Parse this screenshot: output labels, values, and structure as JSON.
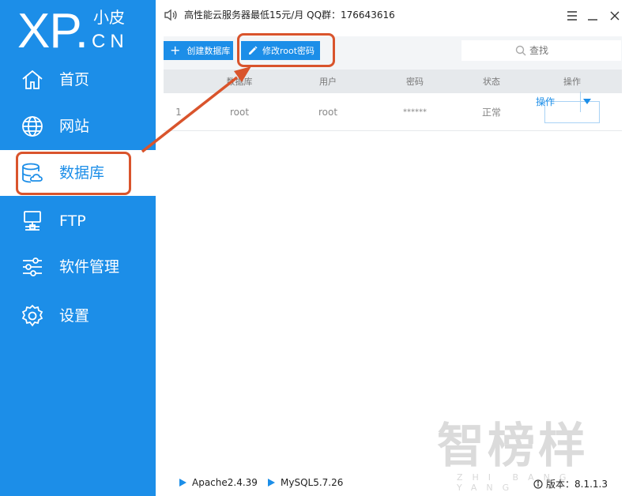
{
  "logo": {
    "main": "XP.",
    "small": "小皮",
    "domain": "CN"
  },
  "sidebar": {
    "items": [
      {
        "label": "首页",
        "icon": "home-icon"
      },
      {
        "label": "网站",
        "icon": "globe-icon"
      },
      {
        "label": "数据库",
        "icon": "database-icon",
        "active": true
      },
      {
        "label": "FTP",
        "icon": "server-icon"
      },
      {
        "label": "软件管理",
        "icon": "sliders-icon"
      },
      {
        "label": "设置",
        "icon": "gear-icon"
      }
    ]
  },
  "topbar": {
    "notice": "高性能云服务器最低15元/月  QQ群：176643616"
  },
  "toolbar": {
    "create_label": "创建数据库",
    "root_label": "修改root密码"
  },
  "search": {
    "placeholder": "查找"
  },
  "table": {
    "headers": [
      "数据库",
      "用户",
      "密码",
      "状态",
      "操作"
    ],
    "rows": [
      {
        "index": "1",
        "database": "root",
        "user": "root",
        "password": "******",
        "status": "正常",
        "action": "操作"
      }
    ]
  },
  "footer": {
    "apache": "Apache2.4.39",
    "mysql": "MySQL5.7.26",
    "version": "版本：8.1.1.3"
  },
  "watermark": {
    "main": "智榜样",
    "sub": "ZHI BANG YANG"
  },
  "colors": {
    "accent": "#1c8ee8",
    "annotation": "#d9542c"
  }
}
